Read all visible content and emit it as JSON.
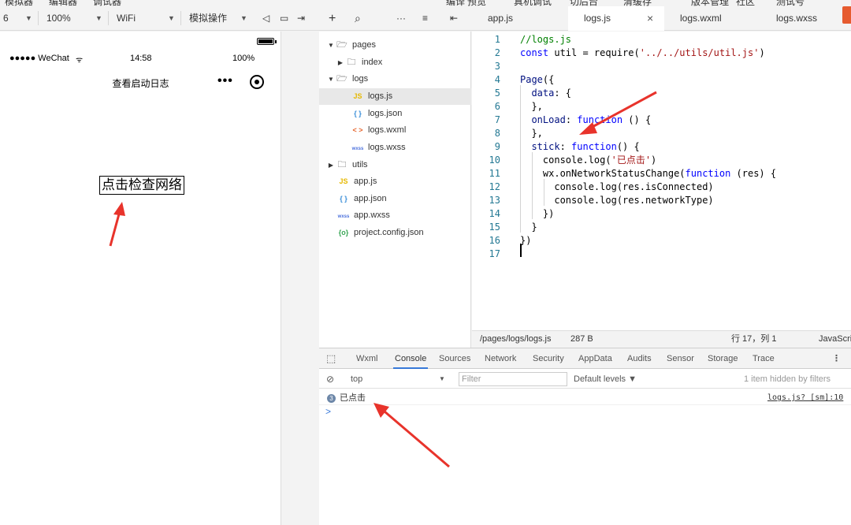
{
  "menu_strip": [
    "模拟器",
    "编辑器",
    "调试器",
    "编译",
    "预览",
    "真机调试",
    "切后台",
    "清缓存",
    "版本管理",
    "社区",
    "测试号"
  ],
  "toolbar": {
    "device": "6",
    "zoom": "100%",
    "network": "WiFi",
    "simulate_action": "模拟操作"
  },
  "simulator": {
    "carrier": "●●●●● WeChat",
    "time": "14:58",
    "battery": "100%",
    "nav_title": "查看启动日志",
    "capsule_dots": "•••",
    "check_network_button": "点击检查网络"
  },
  "file_tree": [
    {
      "label": "pages",
      "type": "folder",
      "expanded": true
    },
    {
      "label": "index",
      "type": "folder",
      "expanded": false
    },
    {
      "label": "logs",
      "type": "folder",
      "expanded": true
    },
    {
      "label": "logs.js",
      "type": "js",
      "selected": true
    },
    {
      "label": "logs.json",
      "type": "json"
    },
    {
      "label": "logs.wxml",
      "type": "wxml"
    },
    {
      "label": "logs.wxss",
      "type": "wxss"
    },
    {
      "label": "utils",
      "type": "folder",
      "expanded": false
    },
    {
      "label": "app.js",
      "type": "js"
    },
    {
      "label": "app.json",
      "type": "json"
    },
    {
      "label": "app.wxss",
      "type": "wxss"
    },
    {
      "label": "project.config.json",
      "type": "config"
    }
  ],
  "file_icons": {
    "js": "JS",
    "json": "{ }",
    "wxml": "< >",
    "wxss": "wxss",
    "config": "{o}"
  },
  "editor_tabs": [
    {
      "label": "app.js",
      "active": false
    },
    {
      "label": "logs.js",
      "active": true
    },
    {
      "label": "logs.wxml",
      "active": false
    },
    {
      "label": "logs.wxss",
      "active": false
    }
  ],
  "code_lines": [
    "//logs.js",
    "const util = require('../../utils/util.js')",
    "",
    "Page({",
    "  data: {",
    "  },",
    "  onLoad: function () {",
    "  },",
    "  stick: function() {",
    "    console.log('已点击')",
    "    wx.onNetworkStatusChange(function (res) {",
    "      console.log(res.isConnected)",
    "      console.log(res.networkType)",
    "    })",
    "  }",
    "})",
    ""
  ],
  "editor_status": {
    "path": "/pages/logs/logs.js",
    "size": "287 B",
    "position": "行 17，列 1",
    "language": "JavaScript"
  },
  "devtools": {
    "tabs": [
      "Wxml",
      "Console",
      "Sources",
      "Network",
      "Security",
      "AppData",
      "Audits",
      "Sensor",
      "Storage",
      "Trace"
    ],
    "active_tab": "Console",
    "context": "top",
    "filter_placeholder": "Filter",
    "levels": "Default levels ▼",
    "hidden_info": "1 item hidden by filters",
    "message_count": "3",
    "message": "已点击",
    "message_source": "logs.js? [sm]:10",
    "prompt": ">"
  }
}
